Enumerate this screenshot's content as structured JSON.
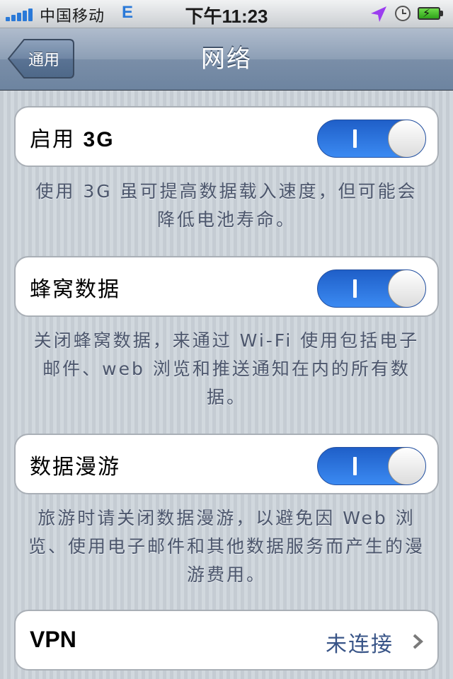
{
  "status_bar": {
    "carrier": "中国移动",
    "network_type": "E",
    "time": "下午11:23",
    "icons": [
      "signal-icon",
      "location-icon",
      "clock-icon",
      "battery-charging-icon"
    ]
  },
  "nav_bar": {
    "back_label": "通用",
    "title": "网络"
  },
  "groups": [
    {
      "label_prefix": "启用",
      "label_bold": "3G",
      "switch_on": true,
      "footer": "使用 3G 虽可提高数据载入速度，但可能会降低电池寿命。"
    },
    {
      "label": "蜂窝数据",
      "switch_on": true,
      "footer": "关闭蜂窝数据，来通过 Wi-Fi 使用包括电子邮件、web 浏览和推送通知在内的所有数据。"
    },
    {
      "label": "数据漫游",
      "switch_on": true,
      "footer": "旅游时请关闭数据漫游，以避免因 Web 浏览、使用电子邮件和其他数据服务而产生的漫游费用。"
    }
  ],
  "vpn": {
    "label": "VPN",
    "value": "未连接"
  },
  "colors": {
    "switch_on": "#2b74e0",
    "nav_bar": "#7f93ad",
    "footer_text": "#4c566c",
    "detail_text": "#385487"
  }
}
